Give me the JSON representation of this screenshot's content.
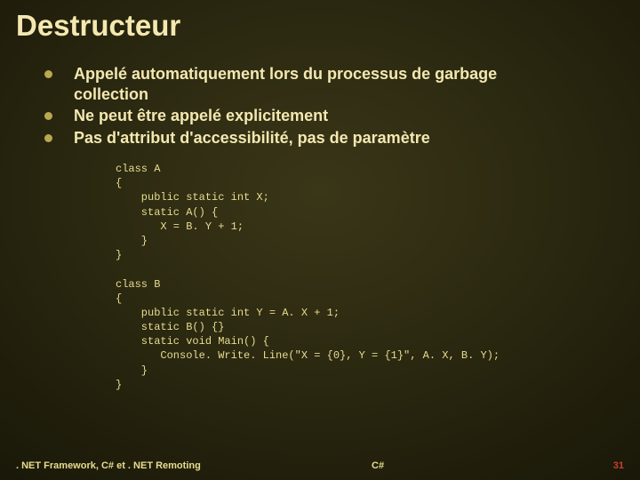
{
  "title": "Destructeur",
  "bullets": [
    "Appelé automatiquement lors du processus de garbage collection",
    "Ne peut être appelé explicitement",
    "Pas d'attribut d'accessibilité, pas de paramètre"
  ],
  "code": "class A\n{\n    public static int X;\n    static A() {\n       X = B. Y + 1;\n    }\n}\n\nclass B\n{\n    public static int Y = A. X + 1;\n    static B() {}\n    static void Main() {\n       Console. Write. Line(\"X = {0}, Y = {1}\", A. X, B. Y);\n    }\n}",
  "footer": {
    "left": ". NET Framework, C# et . NET Remoting",
    "center": "C#",
    "right": "31"
  }
}
